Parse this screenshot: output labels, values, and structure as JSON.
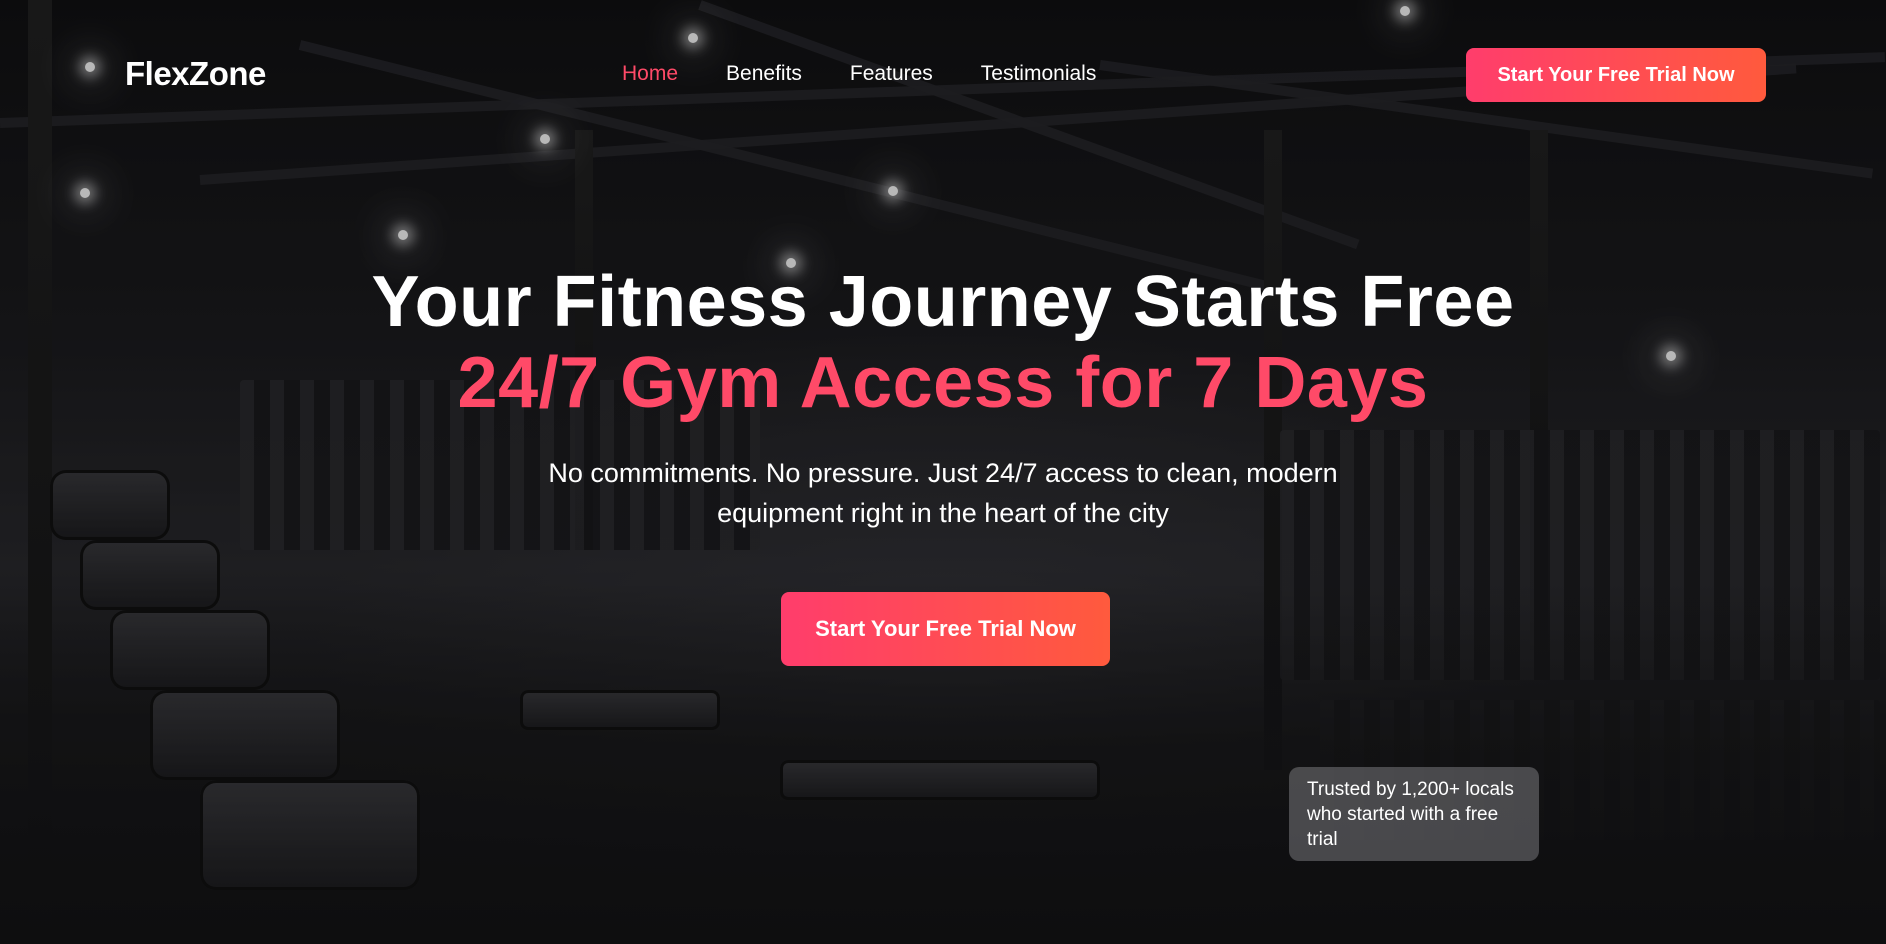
{
  "brand": {
    "logo": "FlexZone",
    "accent": "#ff4a68"
  },
  "nav": {
    "items": [
      {
        "label": "Home",
        "active": true
      },
      {
        "label": "Benefits",
        "active": false
      },
      {
        "label": "Features",
        "active": false
      },
      {
        "label": "Testimonials",
        "active": false
      }
    ],
    "cta_label": "Start Your Free Trial Now"
  },
  "hero": {
    "title": "Your Fitness Journey Starts Free",
    "title_accent": "24/7 Gym Access for 7 Days",
    "subtext": "No commitments. No pressure. Just 24/7 access to clean, modern equipment right in the heart of the city",
    "cta_label": "Start Your Free Trial Now"
  },
  "trust_badge": {
    "text": "Trusted by 1,200+ locals who started with a free trial"
  }
}
